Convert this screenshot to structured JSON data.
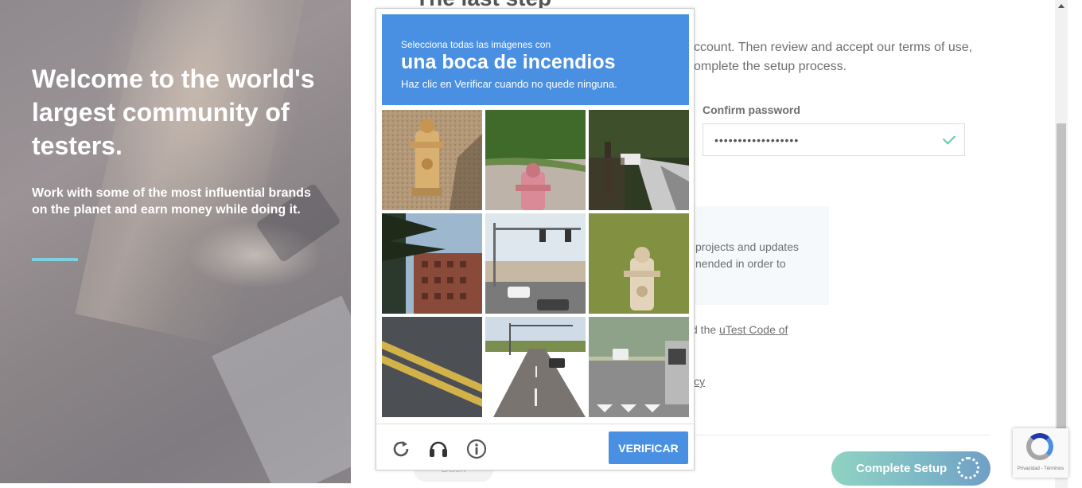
{
  "hero": {
    "title": "Welcome to the world's largest community of testers.",
    "subtitle": "Work with some of the most influential brands on the planet and earn money while doing it.",
    "accent_color": "#7fd0df"
  },
  "form": {
    "title": "The last step",
    "intro": "ccount. Then review and accept our terms of use, omplete the setup process.",
    "confirm_password": {
      "label": "Confirm password",
      "value": "••••••••••••••••••",
      "valid_icon": "check-icon"
    },
    "info_text": "projects and updates nended in order to",
    "agree_prefix": "d the ",
    "code_link": "uTest Code of",
    "policy_link": "icy",
    "back_label": "Back",
    "complete_label": "Complete Setup",
    "complete_state": "loading"
  },
  "captcha": {
    "instruction": "Selecciona todas las imágenes con",
    "target": "una boca de incendios",
    "note": "Haz clic en Verificar cuando no quede ninguna.",
    "verify_label": "VERIFICAR",
    "header_color": "#4a90e2",
    "tiles": [
      {
        "content": "fire hydrant on gravel"
      },
      {
        "content": "red hydrant near grass"
      },
      {
        "content": "street with trees"
      },
      {
        "content": "palm and brick building"
      },
      {
        "content": "intersection with traffic lights"
      },
      {
        "content": "fire hydrant on grass"
      },
      {
        "content": "road markings"
      },
      {
        "content": "multi-lane road"
      },
      {
        "content": "crosswalk and bus"
      }
    ],
    "icons": [
      "reload-icon",
      "audio-icon",
      "info-icon"
    ]
  },
  "recaptcha_badge": {
    "links": "Privacidad - Términos"
  }
}
